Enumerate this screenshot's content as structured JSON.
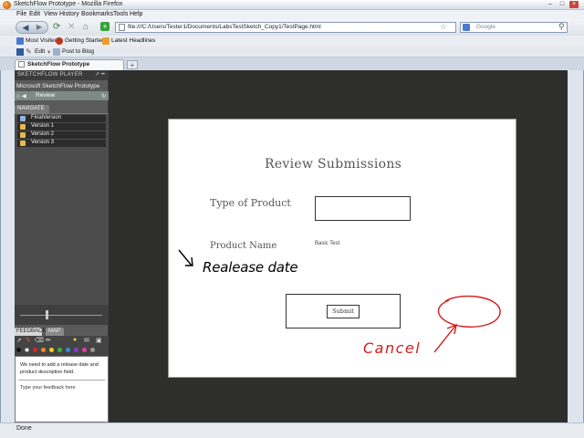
{
  "browser": {
    "title": "SketchFlow Prototype - Mozilla Firefox",
    "menu": [
      "File",
      "Edit",
      "View",
      "History",
      "Bookmarks",
      "Tools",
      "Help"
    ],
    "url": "file:///C:/Users/Tester1/Documents/LabsTestSketch_Copy1/TestPage.html",
    "search_placeholder": "Google",
    "bookmarks": [
      "Most Visited",
      "Getting Started",
      "Latest Headlines"
    ],
    "toolbar2": {
      "edit": "Edit",
      "post": "Post to Blog"
    },
    "tab_title": "SketchFlow Prototype",
    "status": "Done"
  },
  "player": {
    "header": "SKETCHFLOW PLAYER",
    "project": "Microsoft SketchFlow Prototype",
    "screen": "Review",
    "navigate_tab": "NAVIGATE",
    "nav_items": [
      {
        "label": "FinalVersion",
        "color": "#8fb4e6"
      },
      {
        "label": "Version 1",
        "color": "#e8b84a"
      },
      {
        "label": "Version 2",
        "color": "#e8b84a"
      },
      {
        "label": "Version 3",
        "color": "#e8b84a"
      }
    ],
    "feedback_tab": "FEEDBACK",
    "map_tab": "MAP",
    "feedback_text": "We need to add a release date and product description field.",
    "feedback_placeholder": "Type your feedback here",
    "swatch_colors": [
      "#111111",
      "#ffffff",
      "#e02020",
      "#f08a1e",
      "#f2d21a",
      "#3db33d",
      "#2a8fe0",
      "#8a3ad0",
      "#e83aa8",
      "#999999"
    ]
  },
  "sketch": {
    "title": "Review Submissions",
    "type_label": "Type of Product",
    "name_label": "Product Name",
    "name_value": "Basic Test",
    "submit_label": "Submit",
    "note_release": "Realease date",
    "note_cancel": "Cancel",
    "ink_black": "#000000",
    "ink_red": "#d41b1b"
  }
}
